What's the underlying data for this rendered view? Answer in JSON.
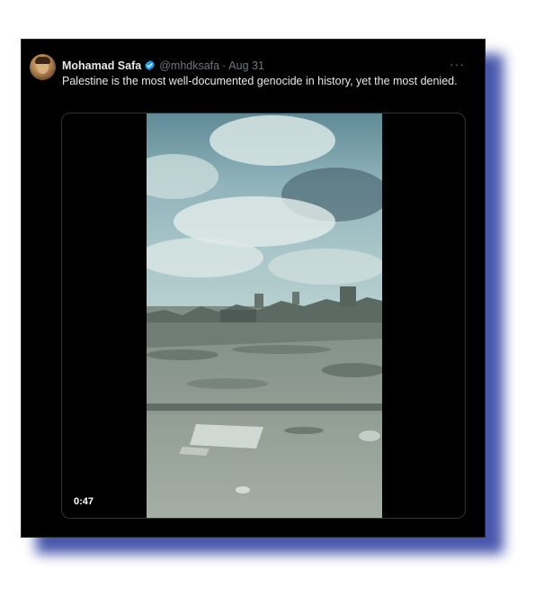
{
  "tweet": {
    "author_name": "Mohamad Safa",
    "handle": "@mhdksafa",
    "separator": "·",
    "date": "Aug 31",
    "text": "Palestine is the most well-documented genocide in history, yet the most denied.",
    "more_label": "···"
  },
  "media": {
    "type": "video",
    "duration": "0:47"
  },
  "colors": {
    "card_background": "#000000",
    "text_primary": "#e7e9ea",
    "text_secondary": "#71767b",
    "verified_blue": "#1d9bf0",
    "drop_shadow": "#3f4ea8"
  },
  "icons": {
    "verified": "verified-badge-icon",
    "more": "more-options-icon"
  }
}
